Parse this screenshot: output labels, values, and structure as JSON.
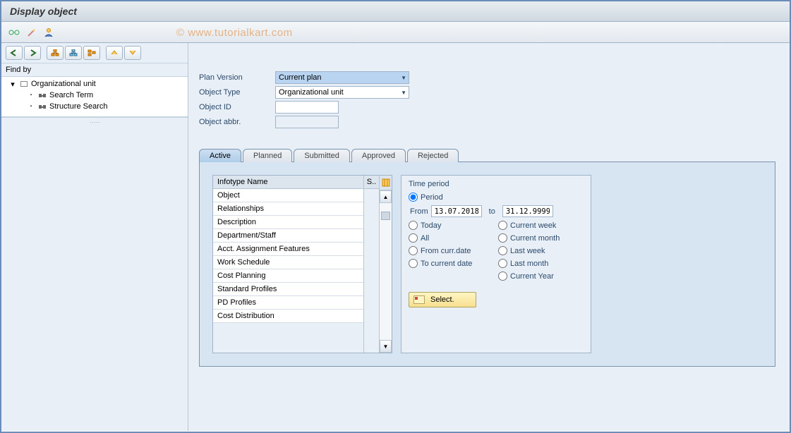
{
  "header": {
    "title": "Display object"
  },
  "watermark": "© www.tutorialkart.com",
  "sidebar": {
    "findby_label": "Find by",
    "tree": {
      "root": "Organizational unit",
      "children": [
        {
          "label": "Search Term"
        },
        {
          "label": "Structure Search"
        }
      ]
    }
  },
  "form": {
    "plan_version": {
      "label": "Plan Version",
      "value": "Current plan"
    },
    "object_type": {
      "label": "Object Type",
      "value": "Organizational unit"
    },
    "object_id": {
      "label": "Object ID",
      "value": ""
    },
    "object_abbr": {
      "label": "Object abbr.",
      "value": ""
    }
  },
  "tabs": [
    "Active",
    "Planned",
    "Submitted",
    "Approved",
    "Rejected"
  ],
  "infotype": {
    "header": "Infotype Name",
    "s_header": "S..",
    "rows": [
      "Object",
      "Relationships",
      "Description",
      "Department/Staff",
      "Acct. Assignment Features",
      "Work Schedule",
      "Cost Planning",
      "Standard Profiles",
      "PD Profiles",
      "Cost Distribution"
    ]
  },
  "time_period": {
    "title": "Time period",
    "radio_period": "Period",
    "from_label": "From",
    "from_value": "13.07.2018",
    "to_label": "to",
    "to_value": "31.12.9999",
    "options_left": [
      "Today",
      "All",
      "From curr.date",
      "To current date"
    ],
    "options_right": [
      "Current week",
      "Current month",
      "Last week",
      "Last month",
      "Current Year"
    ],
    "select_button": "Select."
  }
}
